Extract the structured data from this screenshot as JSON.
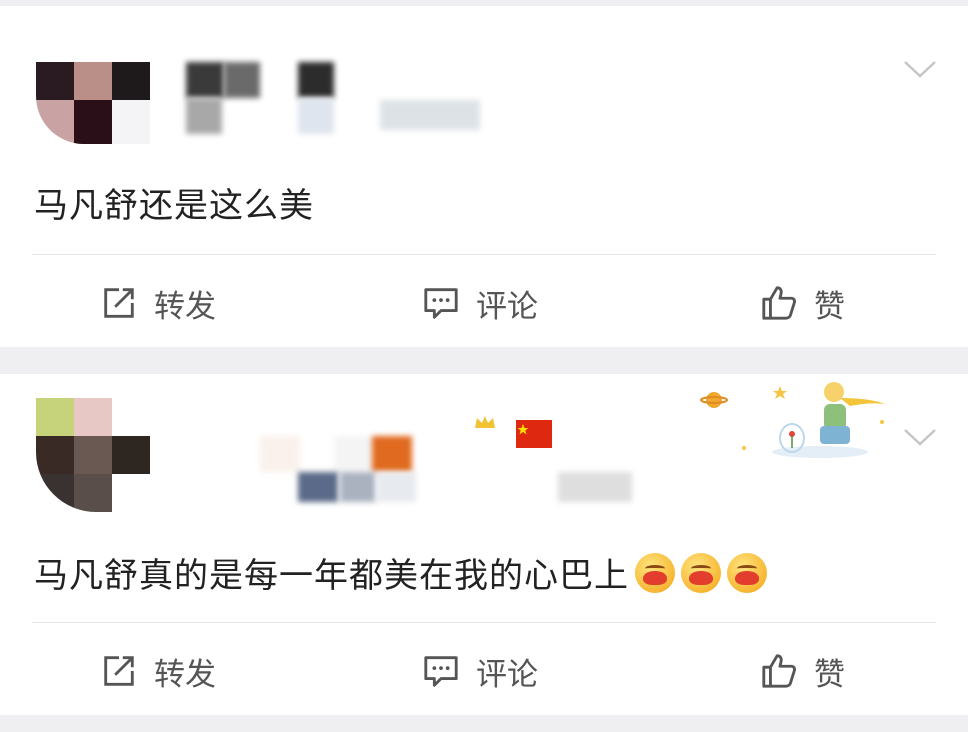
{
  "colors": {
    "background": "#efeff1",
    "card": "#ffffff",
    "text": "#222222",
    "action_text": "#555555",
    "divider": "#e6e6e6",
    "flag_red": "#de2910",
    "accent_orange": "#e06a1f"
  },
  "posts": [
    {
      "content": "马凡舒还是这么美",
      "actions": {
        "repost_label": "转发",
        "comment_label": "评论",
        "like_label": "赞"
      },
      "icons": [
        "repost-icon",
        "comment-icon",
        "like-icon",
        "chevron-down-icon"
      ]
    },
    {
      "content": "马凡舒真的是每一年都美在我的心巴上",
      "emoji_count": 3,
      "emoji_name": "hug-heart-emoji",
      "actions": {
        "repost_label": "转发",
        "comment_label": "评论",
        "like_label": "赞"
      },
      "icons": [
        "repost-icon",
        "comment-icon",
        "like-icon",
        "chevron-down-icon"
      ]
    }
  ]
}
